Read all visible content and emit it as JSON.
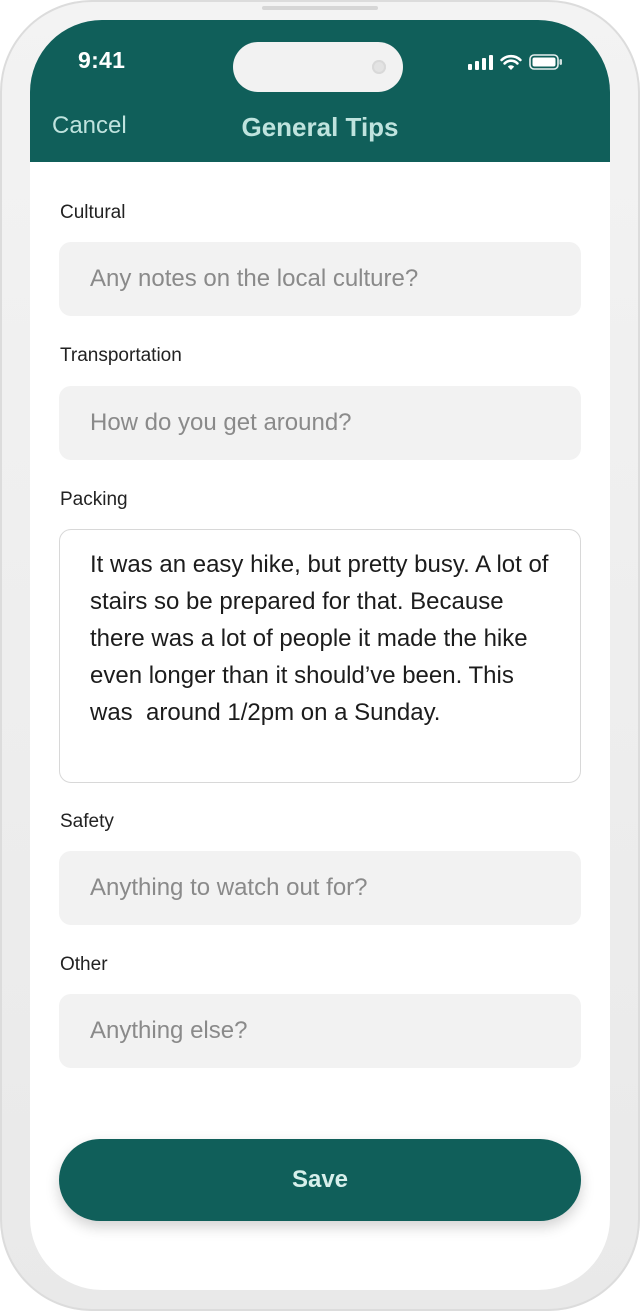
{
  "status_bar": {
    "time": "9:41",
    "icons": [
      "signal-icon",
      "wifi-icon",
      "battery-icon"
    ]
  },
  "header": {
    "cancel_label": "Cancel",
    "title": "General Tips"
  },
  "form": {
    "cultural": {
      "label": "Cultural",
      "placeholder": "Any notes on the local culture?",
      "value": ""
    },
    "transportation": {
      "label": "Transportation",
      "placeholder": "How do you get around?",
      "value": ""
    },
    "packing": {
      "label": "Packing",
      "value": "It was an easy hike, but pretty busy. A lot of stairs so be prepared for that. Because there was a lot of people it made the hike even longer than it should’ve been. This was  around 1/2pm on a Sunday."
    },
    "safety": {
      "label": "Safety",
      "placeholder": "Anything to watch out for?",
      "value": ""
    },
    "other": {
      "label": "Other",
      "placeholder": "Anything else?",
      "value": ""
    }
  },
  "save_label": "Save",
  "colors": {
    "primary": "#105f5a",
    "header_text": "#bfe3de",
    "field_bg": "#f2f2f2"
  }
}
